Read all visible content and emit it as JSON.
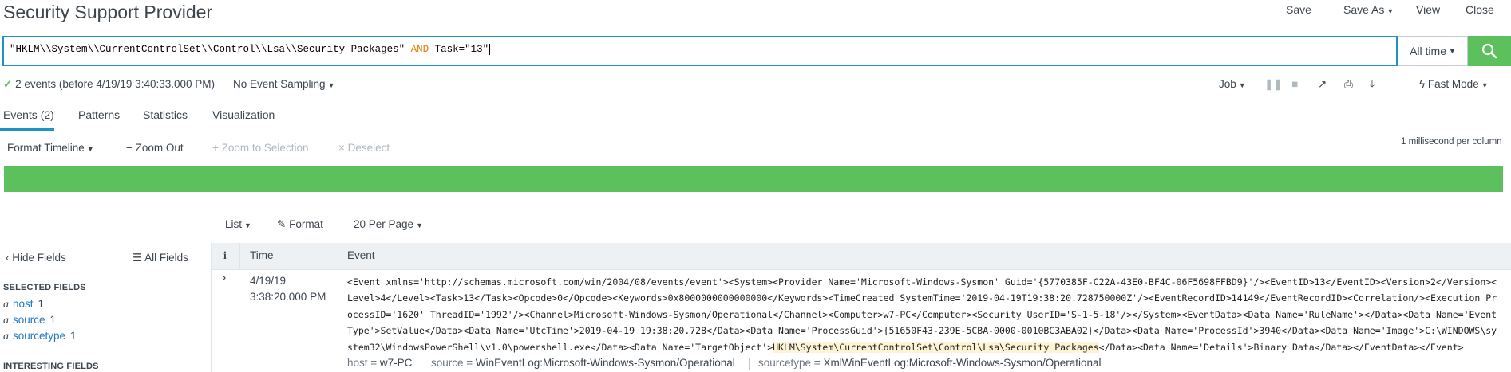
{
  "app": {
    "title": "Security Support Provider",
    "nav": {
      "save": "Save",
      "save_as": "Save As",
      "view": "View",
      "close": "Close"
    }
  },
  "search": {
    "query_part1": "\"HKLM\\\\System\\\\CurrentControlSet\\\\Control\\\\Lsa\\\\Security Packages\"",
    "operator": "AND",
    "query_part2": "Task=\"13\"",
    "time_range": "All time"
  },
  "status": {
    "events_summary": "2 events (before 4/19/19 3:40:33.000 PM)",
    "sampling": "No Event Sampling",
    "job": "Job",
    "mode": "Fast Mode"
  },
  "tabs": [
    {
      "label": "Events (2)",
      "active": true
    },
    {
      "label": "Patterns"
    },
    {
      "label": "Statistics"
    },
    {
      "label": "Visualization"
    }
  ],
  "timeline": {
    "format": "Format Timeline",
    "zoom_out": "Zoom Out",
    "zoom_selection": "Zoom to Selection",
    "deselect": "Deselect",
    "scale": "1 millisecond per column",
    "bar_color": "#5cc05c"
  },
  "results": {
    "list": "List",
    "format": "Format",
    "per_page": "20 Per Page"
  },
  "sidebar": {
    "hide_fields": "Hide Fields",
    "all_fields": "All Fields",
    "selected_heading": "SELECTED FIELDS",
    "selected": [
      {
        "name": "host",
        "count": "1"
      },
      {
        "name": "source",
        "count": "1"
      },
      {
        "name": "sourcetype",
        "count": "1"
      }
    ],
    "interesting_heading": "INTERESTING FIELDS",
    "type_glyph": "a"
  },
  "table": {
    "col_info": "i",
    "col_time": "Time",
    "col_event": "Event"
  },
  "event": {
    "date": "4/19/19",
    "time": "3:38:20.000 PM",
    "line1": "<Event xmlns='http://schemas.microsoft.com/win/2004/08/events/event'><System><Provider Name='Microsoft-Windows-Sysmon' Guid='{5770385F-C22A-43E0-BF4C-06F5698FFBD9}'/><EventID>13</EventID><Version>2</Version><",
    "line2": "Level>4</Level><Task>13</Task><Opcode>0</Opcode><Keywords>0x8000000000000000</Keywords><TimeCreated SystemTime='2019-04-19T19:38:20.728750000Z'/><EventRecordID>14149</EventRecordID><Correlation/><Execution Pr",
    "line3": "ocessID='1620' ThreadID='1992'/><Channel>Microsoft-Windows-Sysmon/Operational</Channel><Computer>w7-PC</Computer><Security UserID='S-1-5-18'/></System><EventData><Data Name='RuleName'></Data><Data Name='Event",
    "line4": "Type'>SetValue</Data><Data Name='UtcTime'>2019-04-19 19:38:20.728</Data><Data Name='ProcessGuid'>{51650F43-239E-5CBA-0000-0010BC3ABA02}</Data><Data Name='ProcessId'>3940</Data><Data Name='Image'>C:\\WINDOWS\\sy",
    "line5_pre": "stem32\\WindowsPowerShell\\v1.0\\powershell.exe</Data><Data Name='TargetObject'>",
    "line5_hl": "HKLM\\System\\CurrentControlSet\\Control\\Lsa\\Security Packages",
    "line5_post": "</Data><Data Name='Details'>Binary Data</Data></EventData></Event>",
    "fields": [
      {
        "key": "host",
        "value": "w7-PC"
      },
      {
        "key": "source",
        "value": "WinEventLog:Microsoft-Windows-Sysmon/Operational"
      },
      {
        "key": "sourcetype",
        "value": "XmlWinEventLog:Microsoft-Windows-Sysmon/Operational"
      }
    ]
  }
}
